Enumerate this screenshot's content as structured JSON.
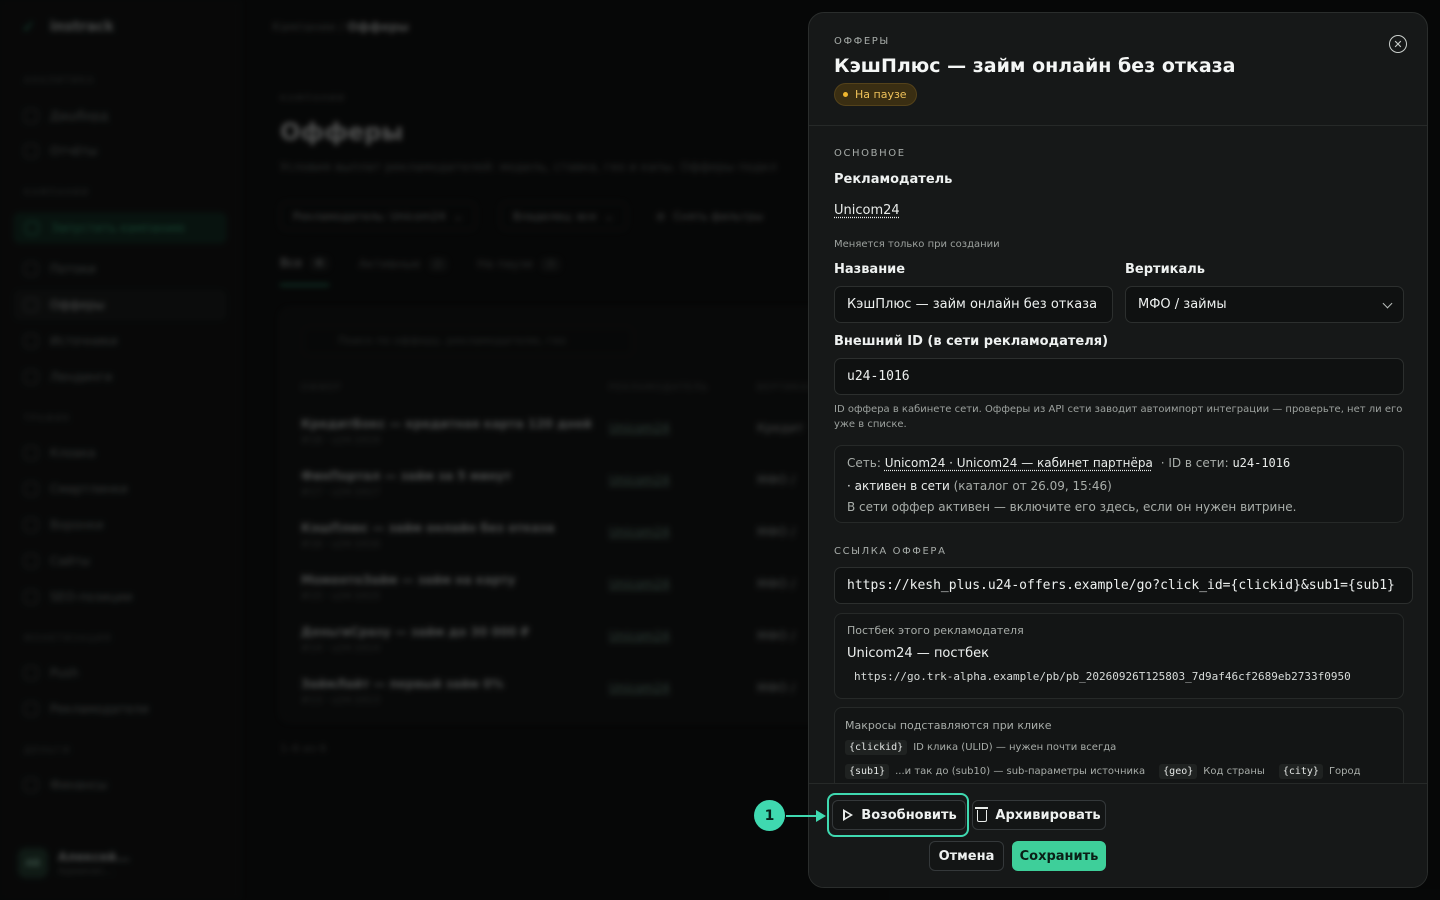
{
  "background": {
    "brand": "instrack",
    "nav": {
      "sections": [
        "АНАЛИТИКА",
        "КАМПАНИИ",
        "ТРАФИК",
        "МОНЕТИЗАЦИЯ",
        "ДЕНЬГИ"
      ],
      "items": [
        "Дашборд",
        "Отчёты",
        "Запустить кампанию",
        "Потоки",
        "Офферы",
        "Источники",
        "Лендинги",
        "Клоака",
        "Смартлинки",
        "Воронки",
        "Сайты",
        "SEO-позиции",
        "Push",
        "Рекламодатели",
        "Финансы"
      ]
    },
    "user": {
      "initials": "АБ",
      "name": "Алексей...",
      "role": "Админис..."
    },
    "breadcrumb": {
      "parent": "Кампании",
      "current": "Офферы"
    },
    "eyebrow": "КАМПАНИИ",
    "title": "Офферы",
    "description": "Условия выплат рекламодателей: модель, ставка, гео и капы. Офферы подкл",
    "filters": [
      "Рекламодатель: Unicom24",
      "Владелец: все",
      "Снять фильтры"
    ],
    "tabs": [
      {
        "label": "Все",
        "count": "6"
      },
      {
        "label": "Активные",
        "count": "2"
      },
      {
        "label": "На паузе",
        "count": "3"
      }
    ],
    "search_placeholder": "Поиск по офферу, рекламодателю, гео",
    "columns": [
      "ОФФЕР",
      "РЕКЛАМОДАТЕЛЬ",
      "ВЕРТИКАЛЬ"
    ],
    "rows": [
      {
        "name": "КредитБокс — кредитная карта 120 дней",
        "sub": "#18 · u24-1019",
        "advertiser": "Unicom24",
        "vertical": "Кредит"
      },
      {
        "name": "ФинПортал — займ за 5 минут",
        "sub": "#17 · u24-1017",
        "advertiser": "Unicom24",
        "vertical": "МФО /"
      },
      {
        "name": "КэшПлюс — займ онлайн без отказа",
        "sub": "#16 · u24-1016",
        "advertiser": "Unicom24",
        "vertical": "МФО /"
      },
      {
        "name": "МоментоЗайм — займ на карту",
        "sub": "#15 · u24-1015",
        "advertiser": "Unicom24",
        "vertical": "МФО /"
      },
      {
        "name": "ДеньгиСразу — займ до 30 000 ₽",
        "sub": "#14 · u24-1014",
        "advertiser": "Unicom24",
        "vertical": "МФО /"
      },
      {
        "name": "ЗаймЛайт — первый займ 0%",
        "sub": "#13 · u24-1013",
        "advertiser": "Unicom24",
        "vertical": "МФО /"
      }
    ],
    "pager": "1–6 из 6"
  },
  "drawer": {
    "eyebrow": "ОФФЕРЫ",
    "title": "КэшПлюс — займ онлайн без отказа",
    "status": "На паузе",
    "section_main": "ОСНОВНОЕ",
    "advertiser_label": "Рекламодатель",
    "advertiser_value": "Unicom24",
    "advertiser_hint": "Меняется только при создании",
    "name_label": "Название",
    "name_value": "КэшПлюс — займ онлайн без отказа",
    "vertical_label": "Вертикаль",
    "vertical_value": "МФО / займы",
    "external_id_label": "Внешний ID (в сети рекламодателя)",
    "external_id_value": "u24-1016",
    "external_id_hint": "ID оффера в кабинете сети. Офферы из API сети заводит автоимпорт интеграции — проверьте, нет ли его уже в списке.",
    "network": {
      "label": "Сеть:",
      "link": "Unicom24 · Unicom24 — кабинет партнёра",
      "id_label": "· ID в сети:",
      "id_value": "u24-1016",
      "state": "· активен в сети",
      "catalog": "(каталог от 26.09, 15:46)",
      "note": "В сети оффер активен — включите его здесь, если он нужен витрине."
    },
    "section_link": "ССЫЛКА ОФФЕРА",
    "offer_url": "https://kesh_plus.u24-offers.example/go?click_id={clickid}&sub1={sub1}",
    "postback": {
      "label": "Постбек этого рекламодателя",
      "name": "Unicom24 — постбек",
      "url": "https://go.trk-alpha.example/pb/pb_20260926T125803_7d9af46cf2689eb2733f0950"
    },
    "macros": {
      "title": "Макросы подставляются при клике",
      "items": [
        {
          "code": "{clickid}",
          "desc": "ID клика (ULID) — нужен почти всегда"
        },
        {
          "code": "{sub1}",
          "desc": "...и так до (sub10) — sub-параметры источника"
        },
        {
          "code": "{geo}",
          "desc": "Код страны"
        },
        {
          "code": "{city}",
          "desc": "Город"
        }
      ]
    },
    "footer": {
      "resume": "Возобновить",
      "archive": "Архивировать",
      "cancel": "Отмена",
      "save": "Сохранить"
    }
  },
  "annotation": {
    "number": "1"
  },
  "colors": {
    "accent": "#3ecf9a",
    "highlight": "#3fd9b0",
    "paused": "#f0b72f"
  }
}
